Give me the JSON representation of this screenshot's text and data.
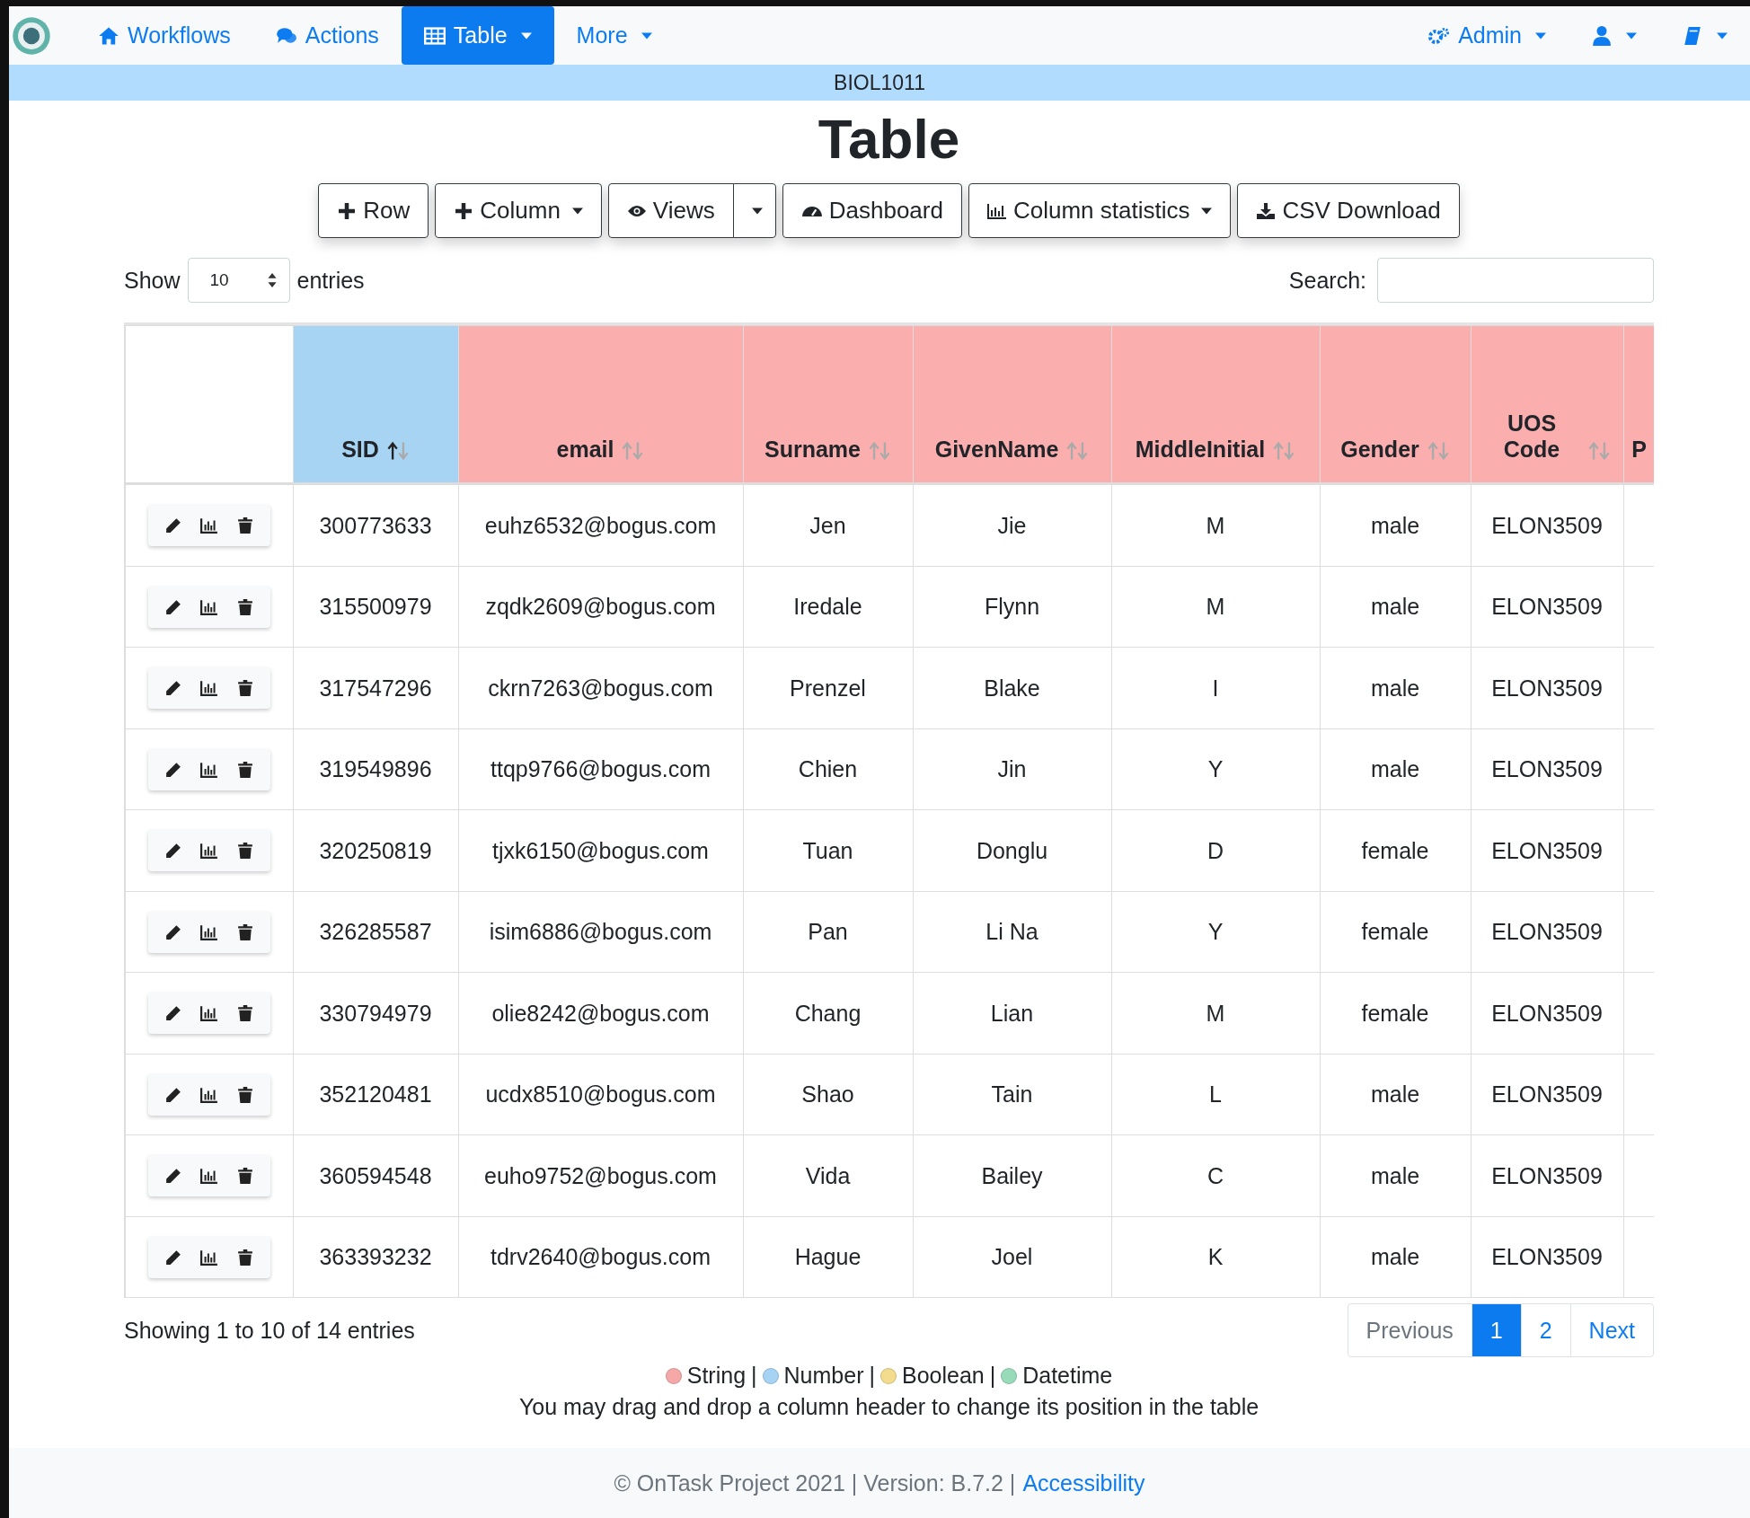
{
  "navbar": {
    "items": [
      {
        "label": "Workflows",
        "selected": false
      },
      {
        "label": "Actions",
        "selected": false
      },
      {
        "label": "Table",
        "selected": true
      },
      {
        "label": "More",
        "selected": false
      }
    ],
    "right_items": [
      {
        "label": "Admin"
      }
    ]
  },
  "workflow_name": "BIOL1011",
  "title": "Table",
  "toolbar": [
    {
      "label": "Row"
    },
    {
      "label": "Column"
    },
    {
      "label": "Views"
    },
    {
      "label": "Dashboard"
    },
    {
      "label": "Column statistics"
    },
    {
      "label": "CSV Download"
    }
  ],
  "length": {
    "before": "Show",
    "value": "10",
    "after": "entries"
  },
  "search": {
    "label": "Search:"
  },
  "table": {
    "columns": [
      {
        "label": "SID",
        "color": "#a8d4f3",
        "sorted": true
      },
      {
        "label": "email",
        "color": "#fbaeae",
        "sorted": false
      },
      {
        "label": "Surname",
        "color": "#fbaeae",
        "sorted": false
      },
      {
        "label": "GivenName",
        "color": "#fbaeae",
        "sorted": false
      },
      {
        "label": "MiddleInitial",
        "color": "#fbaeae",
        "sorted": false
      },
      {
        "label": "Gender",
        "color": "#fbaeae",
        "sorted": false
      },
      {
        "label": "UOS Code",
        "color": "#fbaeae",
        "sorted": false
      },
      {
        "label": "P",
        "color": "#fbaeae"
      }
    ],
    "rows": [
      [
        "300773633",
        "euhz6532@bogus.com",
        "Jen",
        "Jie",
        "M",
        "male",
        "ELON3509"
      ],
      [
        "315500979",
        "zqdk2609@bogus.com",
        "Iredale",
        "Flynn",
        "M",
        "male",
        "ELON3509"
      ],
      [
        "317547296",
        "ckrn7263@bogus.com",
        "Prenzel",
        "Blake",
        "I",
        "male",
        "ELON3509"
      ],
      [
        "319549896",
        "ttqp9766@bogus.com",
        "Chien",
        "Jin",
        "Y",
        "male",
        "ELON3509"
      ],
      [
        "320250819",
        "tjxk6150@bogus.com",
        "Tuan",
        "Donglu",
        "D",
        "female",
        "ELON3509"
      ],
      [
        "326285587",
        "isim6886@bogus.com",
        "Pan",
        "Li Na",
        "Y",
        "female",
        "ELON3509"
      ],
      [
        "330794979",
        "olie8242@bogus.com",
        "Chang",
        "Lian",
        "M",
        "female",
        "ELON3509"
      ],
      [
        "352120481",
        "ucdx8510@bogus.com",
        "Shao",
        "Tain",
        "L",
        "male",
        "ELON3509"
      ],
      [
        "360594548",
        "euho9752@bogus.com",
        "Vida",
        "Bailey",
        "C",
        "male",
        "ELON3509"
      ],
      [
        "363393232",
        "tdrv2640@bogus.com",
        "Hague",
        "Joel",
        "K",
        "male",
        "ELON3509"
      ]
    ]
  },
  "info": "Showing 1 to 10 of 14 entries",
  "pagination": [
    {
      "label": "Previous",
      "selected": false,
      "disabled": true
    },
    {
      "label": "1",
      "selected": true,
      "disabled": false
    },
    {
      "label": "2",
      "selected": false,
      "disabled": false
    },
    {
      "label": "Next",
      "selected": false,
      "disabled": false
    }
  ],
  "legend": [
    {
      "label": "String",
      "color": "#f6a8a8"
    },
    {
      "label": "Number",
      "color": "#a6d3f3"
    },
    {
      "label": "Boolean",
      "color": "#f3dc8e"
    },
    {
      "label": "Datetime",
      "color": "#98dbb9"
    }
  ],
  "separator": "|",
  "hint": "You may drag and drop a column header to change its position in the table",
  "footer": {
    "text": "© OnTask Project 2021 | Version: B.7.2 |",
    "link": "Accessibility"
  }
}
